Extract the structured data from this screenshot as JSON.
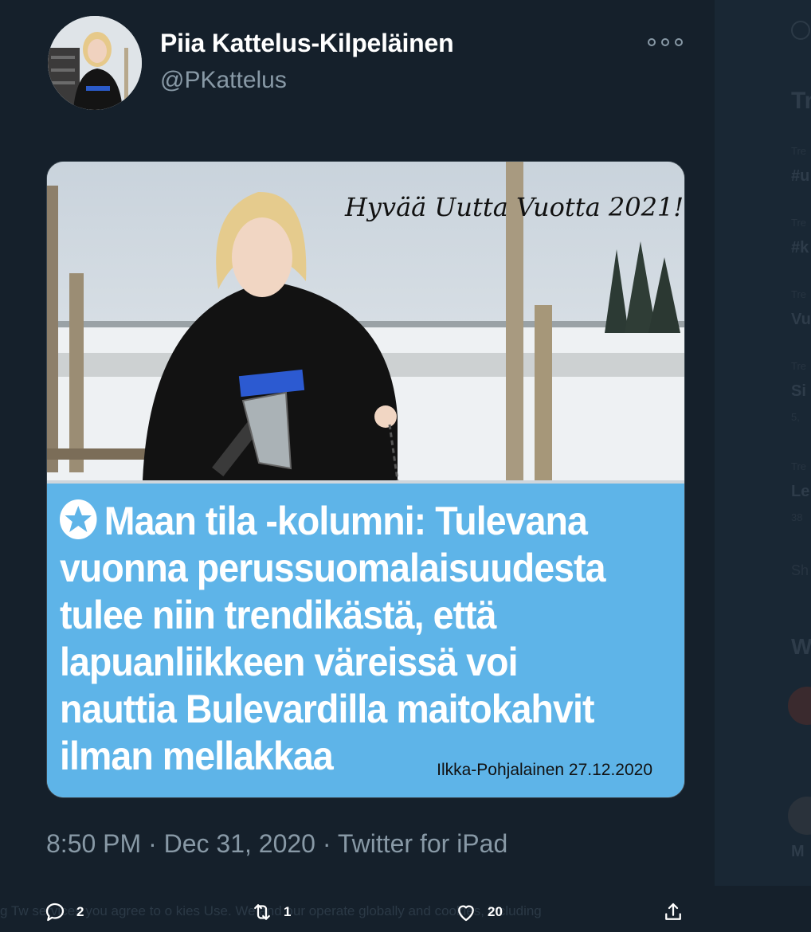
{
  "tweet": {
    "author_name": "Piia Kattelus-Kilpeläinen",
    "author_handle": "@PKattelus",
    "more_icon": "more-icon",
    "image_greeting": "Hyvää Uutta Vuotta 2021!",
    "image_headline": "Maan tila -kolumni: Tulevana vuonna perussuomalaisuudesta tulee niin trendikästä, että lapuanliikkeen väreissä voi nauttia Bulevardilla maitokahvit ilman mellakkaa",
    "image_source": "Ilkka-Pohjalainen 27.12.2020",
    "timestamp": "8:50 PM · Dec 31, 2020 · Twitter for iPad"
  },
  "actions": {
    "reply_count": "2",
    "retweet_count": "1",
    "like_count": "20"
  },
  "cookie_banner": {
    "text": "g Tw   services you agree to o   kies Use. We and our        operate globally and     cookies, including"
  },
  "sidebar": {
    "heading": "Tr",
    "items": [
      {
        "label": "Tre",
        "title": "#u"
      },
      {
        "label": "Tre",
        "title": "#k"
      },
      {
        "label": "Tre",
        "title": "Vu"
      },
      {
        "label": "Tre",
        "title": "Si",
        "sub": "5,"
      },
      {
        "label": "Tre",
        "title": "Le",
        "sub": "38"
      }
    ],
    "show_more": "Sh",
    "who_heading": "W",
    "who_item": "M"
  },
  "colors": {
    "background": "#15202b",
    "headline_box": "#5eb4e8",
    "secondary_text": "#8899a6"
  }
}
